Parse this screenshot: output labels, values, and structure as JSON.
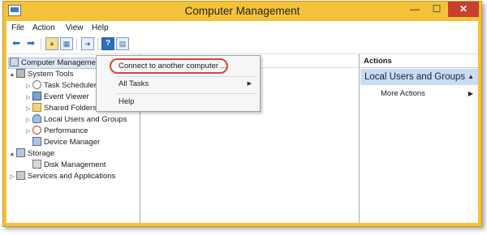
{
  "window": {
    "title": "Computer Management"
  },
  "titlebar_buttons": {
    "minimize": "—",
    "maximize": "☐",
    "close": "✕"
  },
  "menubar": {
    "items": [
      "File",
      "Action",
      "View",
      "Help"
    ]
  },
  "toolbar": {
    "back_icon": "arrow-left-icon",
    "forward_icon": "arrow-right-icon",
    "buttons": [
      "up-folder-icon",
      "show-hide-tree-icon",
      "export-list-icon",
      "help-icon",
      "properties-icon"
    ]
  },
  "tree": {
    "root": "Computer Management (Local)",
    "items": [
      {
        "label": "System Tools",
        "level": 1,
        "expander": "▲",
        "icon": "tools-icon"
      },
      {
        "label": "Task Scheduler",
        "level": 2,
        "expander": "▷",
        "icon": "clock-icon"
      },
      {
        "label": "Event Viewer",
        "level": 2,
        "expander": "▷",
        "icon": "event-viewer-icon"
      },
      {
        "label": "Shared Folders",
        "level": 2,
        "expander": "▷",
        "icon": "shared-folder-icon"
      },
      {
        "label": "Local Users and Groups",
        "level": 2,
        "expander": "▷",
        "icon": "users-icon"
      },
      {
        "label": "Performance",
        "level": 2,
        "expander": "▷",
        "icon": "performance-icon"
      },
      {
        "label": "Device Manager",
        "level": 2,
        "expander": "",
        "icon": "device-manager-icon"
      },
      {
        "label": "Storage",
        "level": 1,
        "expander": "▲",
        "icon": "storage-icon"
      },
      {
        "label": "Disk Management",
        "level": 2,
        "expander": "",
        "icon": "disk-icon"
      },
      {
        "label": "Services and Applications",
        "level": 1,
        "expander": "▷",
        "icon": "services-icon"
      }
    ]
  },
  "context_menu": {
    "items": [
      "Connect to another computer ...",
      "All Tasks",
      "Help"
    ],
    "submenu_arrow": "▶"
  },
  "actions_pane": {
    "header": "Actions",
    "section": "Local Users and Groups",
    "section_collapse": "▲",
    "item": "More Actions",
    "item_arrow": "▶"
  }
}
